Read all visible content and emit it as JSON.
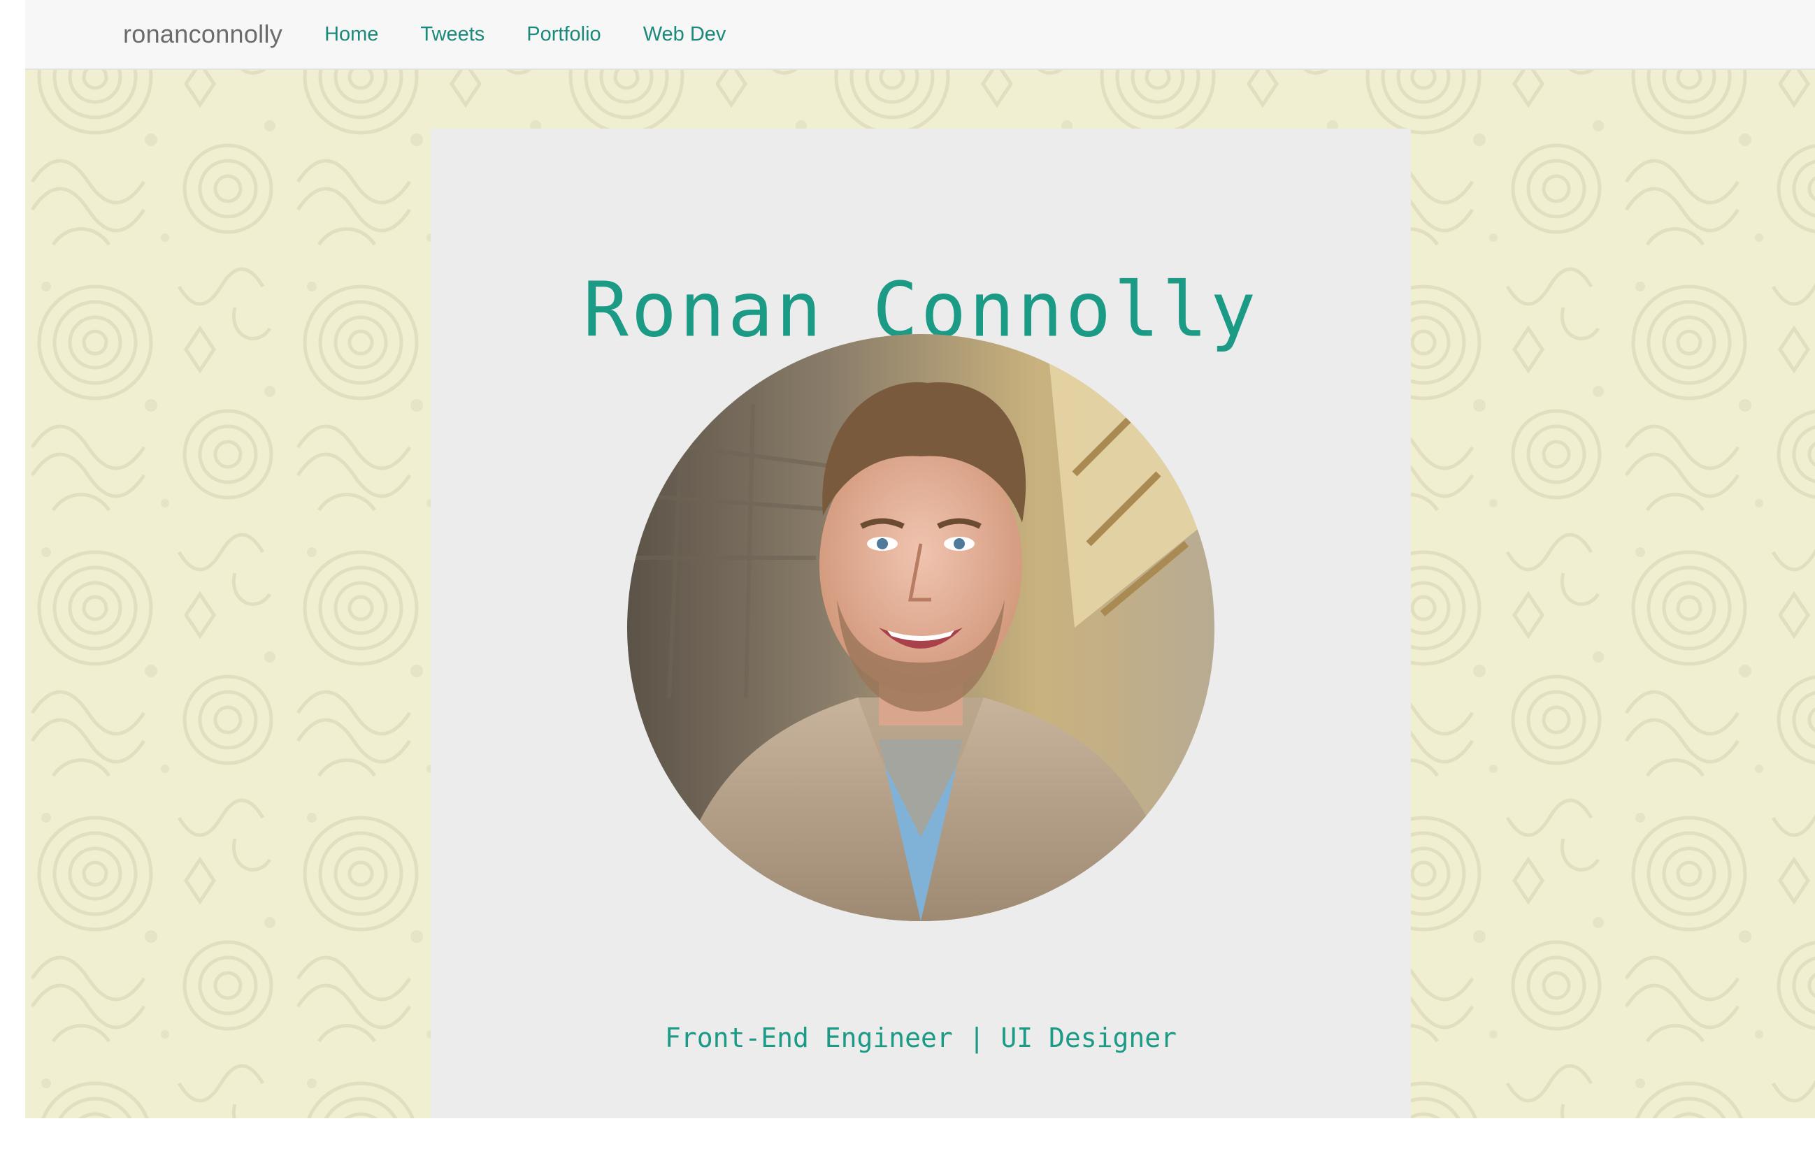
{
  "navbar": {
    "brand": "ronanconnolly",
    "links": [
      {
        "label": "Home"
      },
      {
        "label": "Tweets"
      },
      {
        "label": "Portfolio"
      },
      {
        "label": "Web Dev"
      }
    ]
  },
  "hero": {
    "name": "Ronan Connolly",
    "tagline": "Front-End Engineer | UI Designer",
    "avatar_icon": "profile-photo"
  },
  "colors": {
    "accent": "#1b9a86",
    "nav_link": "#1b8a7a",
    "background_pattern": "#f1efd2",
    "card": "#ececec",
    "navbar": "#f7f7f7"
  }
}
